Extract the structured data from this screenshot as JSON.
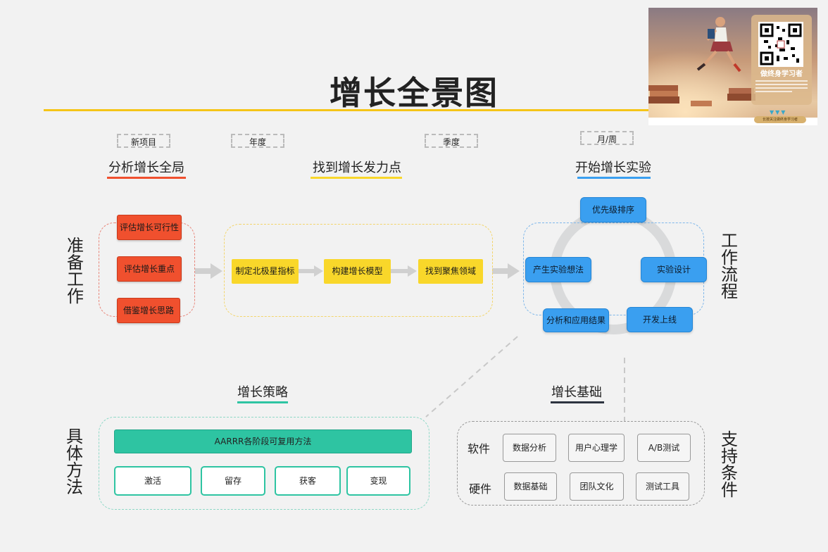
{
  "title": "增长全景图",
  "tags": {
    "t1": "新项目",
    "t2": "年度",
    "t3": "季度",
    "t4": "月/周"
  },
  "sections": {
    "analysis": "分析增长全局",
    "find": "找到增长发力点",
    "experiment": "开始增长实验",
    "strategy": "增长策略",
    "foundation": "增长基础"
  },
  "side_labels": {
    "prep": [
      "准",
      "备",
      "工",
      "作"
    ],
    "workflow": [
      "工",
      "作",
      "流",
      "程"
    ],
    "methods": [
      "具",
      "体",
      "方",
      "法"
    ],
    "support": [
      "支",
      "持",
      "条",
      "件"
    ]
  },
  "prep_steps": [
    "评估增长可行性",
    "评估增长重点",
    "借鉴增长思路"
  ],
  "find_steps": [
    "制定北极星指标",
    "构建增长模型",
    "找到聚焦领域"
  ],
  "cycle_steps": {
    "priority": "优先级排序",
    "design": "实验设计",
    "launch": "开发上线",
    "analyze": "分析和应用结果",
    "ideas": "产生实验想法"
  },
  "strategy": {
    "bar": "AARRR各阶段可复用方法",
    "items": [
      "激活",
      "留存",
      "获客",
      "变现"
    ]
  },
  "foundation": {
    "software_label": "软件",
    "hardware_label": "硬件",
    "software": [
      "数据分析",
      "用户心理学",
      "A/B测试"
    ],
    "hardware": [
      "数据基础",
      "团队文化",
      "测试工具"
    ]
  },
  "ad": {
    "heading": "做终身学习者",
    "button": "长按关注做终身学习者"
  },
  "colors": {
    "red": "#f0502e",
    "yellow": "#f9d72a",
    "blue": "#3a9ff0",
    "green": "#2ec4a2",
    "dark": "#2d3440",
    "title_line": "#f5c518"
  }
}
